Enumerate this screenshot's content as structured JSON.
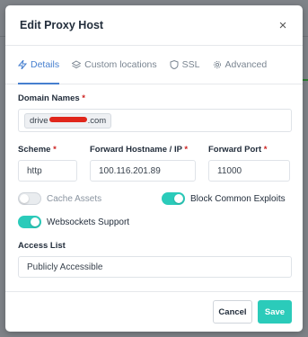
{
  "modal": {
    "title": "Edit Proxy Host",
    "close_symbol": "×"
  },
  "tabs": [
    {
      "label": "Details",
      "icon": "lightning-icon",
      "active": true
    },
    {
      "label": "Custom locations",
      "icon": "layers-icon",
      "active": false
    },
    {
      "label": "SSL",
      "icon": "shield-icon",
      "active": false
    },
    {
      "label": "Advanced",
      "icon": "gear-icon",
      "active": false
    }
  ],
  "domain_names": {
    "label": "Domain Names",
    "required_mark": "*",
    "tag_prefix": "drive",
    "tag_suffix": ".com"
  },
  "scheme": {
    "label": "Scheme",
    "required_mark": "*",
    "value": "http"
  },
  "forward_hostname": {
    "label": "Forward Hostname / IP",
    "required_mark": "*",
    "value": "100.116.201.89"
  },
  "forward_port": {
    "label": "Forward Port",
    "required_mark": "*",
    "value": "11000"
  },
  "toggles": {
    "cache_assets": {
      "label": "Cache Assets",
      "on": false
    },
    "block_exploits": {
      "label": "Block Common Exploits",
      "on": true
    },
    "websockets": {
      "label": "Websockets Support",
      "on": true
    }
  },
  "access_list": {
    "label": "Access List",
    "value": "Publicly Accessible"
  },
  "footer": {
    "cancel_label": "Cancel",
    "save_label": "Save"
  },
  "colors": {
    "accent": "#467fcf",
    "toggle_on": "#2bcbba",
    "required": "#cd201f"
  }
}
